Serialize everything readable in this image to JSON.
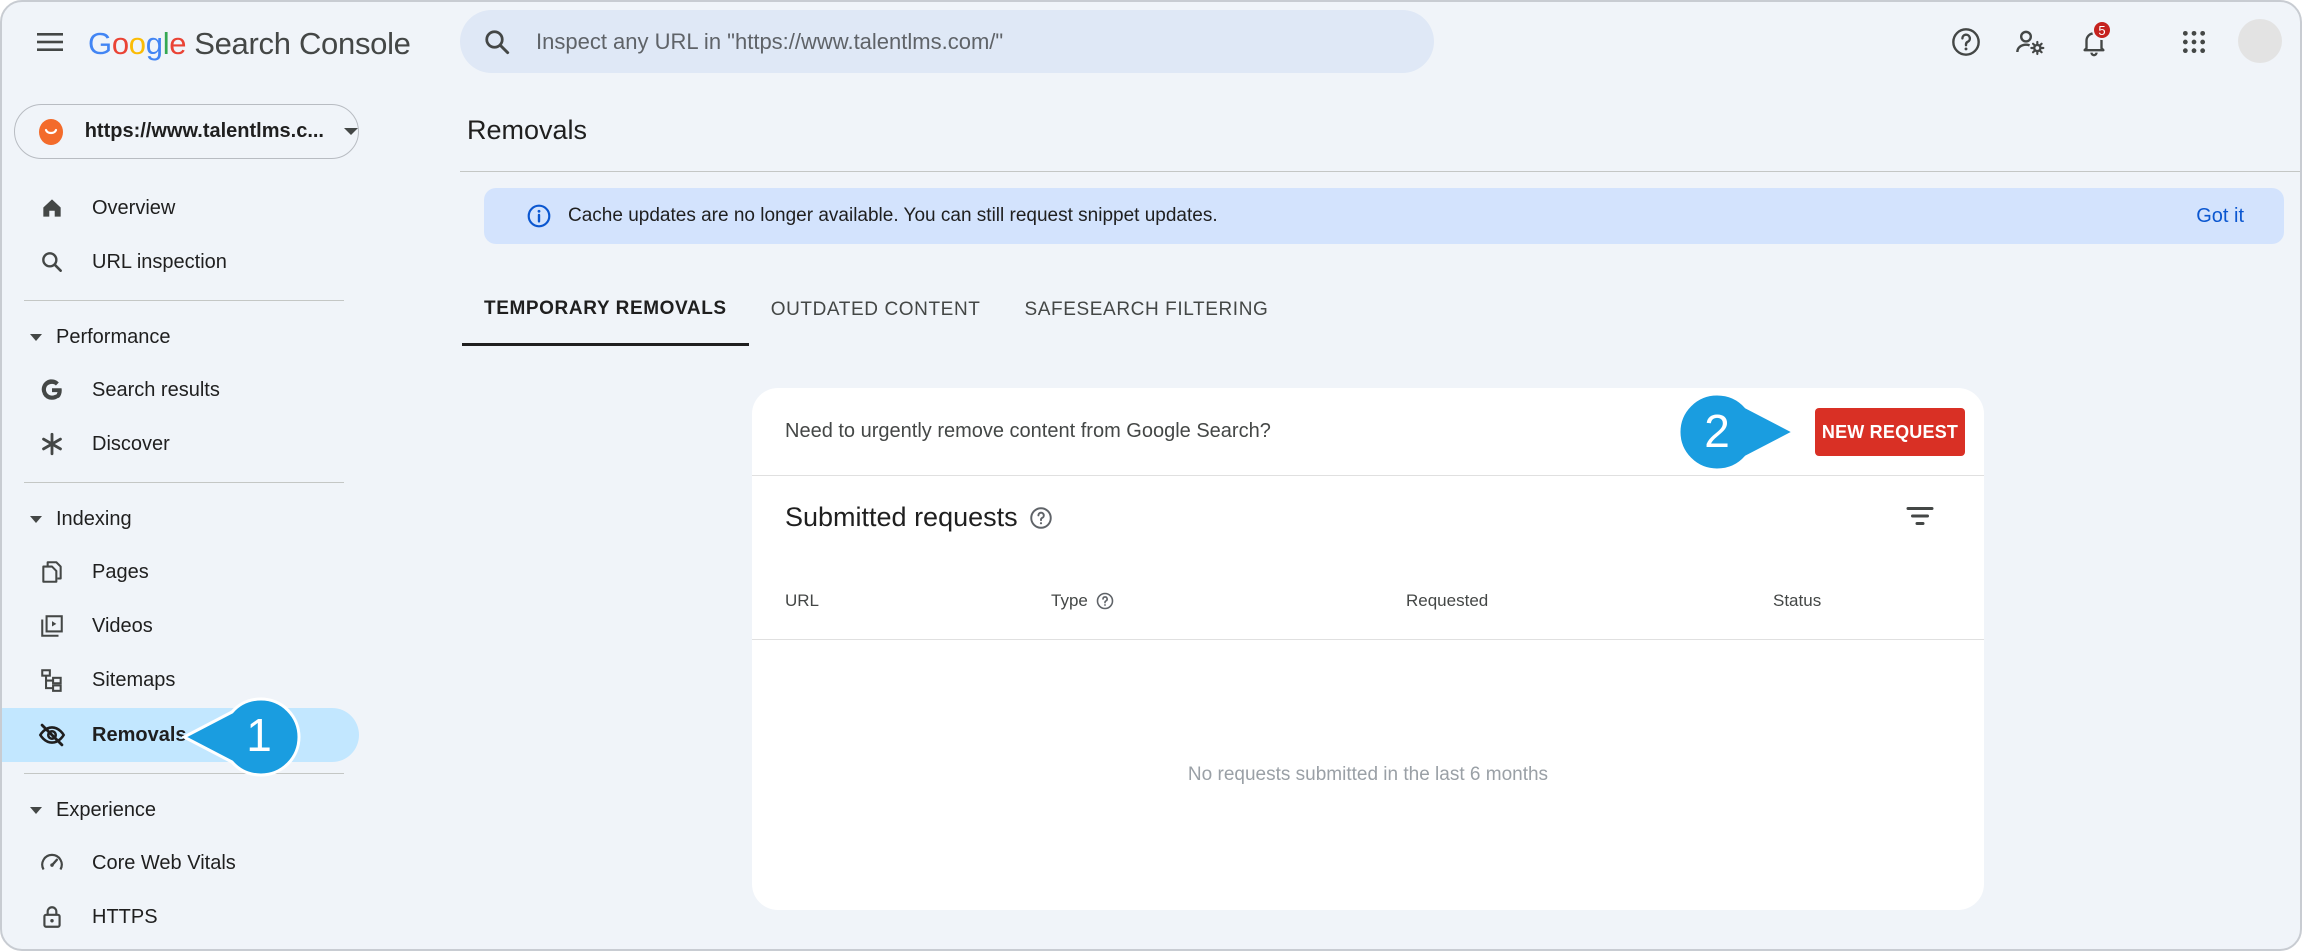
{
  "header": {
    "logo_google": "Google",
    "logo_product": "Search Console",
    "search_placeholder": "Inspect any URL in \"https://www.talentlms.com/\"",
    "notification_count": "5"
  },
  "sidebar": {
    "property_url": "https://www.talentlms.c...",
    "items_top": [
      {
        "label": "Overview",
        "icon": "home-icon"
      },
      {
        "label": "URL inspection",
        "icon": "search-icon"
      }
    ],
    "performance": {
      "label": "Performance",
      "items": [
        {
          "label": "Search results",
          "icon": "google-g-icon"
        },
        {
          "label": "Discover",
          "icon": "asterisk-icon"
        }
      ]
    },
    "indexing": {
      "label": "Indexing",
      "items": [
        {
          "label": "Pages",
          "icon": "pages-icon"
        },
        {
          "label": "Videos",
          "icon": "video-icon"
        },
        {
          "label": "Sitemaps",
          "icon": "sitemap-icon"
        },
        {
          "label": "Removals",
          "icon": "eye-off-icon",
          "active": true
        }
      ]
    },
    "experience": {
      "label": "Experience",
      "items": [
        {
          "label": "Core Web Vitals",
          "icon": "gauge-icon"
        },
        {
          "label": "HTTPS",
          "icon": "lock-icon"
        }
      ]
    }
  },
  "main": {
    "title": "Removals",
    "banner": {
      "message": "Cache updates are no longer available. You can still request snippet updates.",
      "action": "Got it"
    },
    "tabs": [
      {
        "label": "TEMPORARY REMOVALS",
        "active": true
      },
      {
        "label": "OUTDATED CONTENT"
      },
      {
        "label": "SAFESEARCH FILTERING"
      }
    ],
    "card": {
      "question": "Need to urgently remove content from Google Search?",
      "new_request": "NEW REQUEST",
      "subtitle": "Submitted requests",
      "columns": [
        "URL",
        "Type",
        "Requested",
        "Status"
      ],
      "empty_message": "No requests submitted in the last 6 months"
    }
  },
  "callouts": {
    "first": "1",
    "second": "2"
  },
  "colors": {
    "accent_blue": "#0b57d0",
    "active_nav": "#c2e7ff",
    "banner": "#d3e3fd",
    "new_request": "#d93025",
    "callout": "#1a9de0"
  }
}
